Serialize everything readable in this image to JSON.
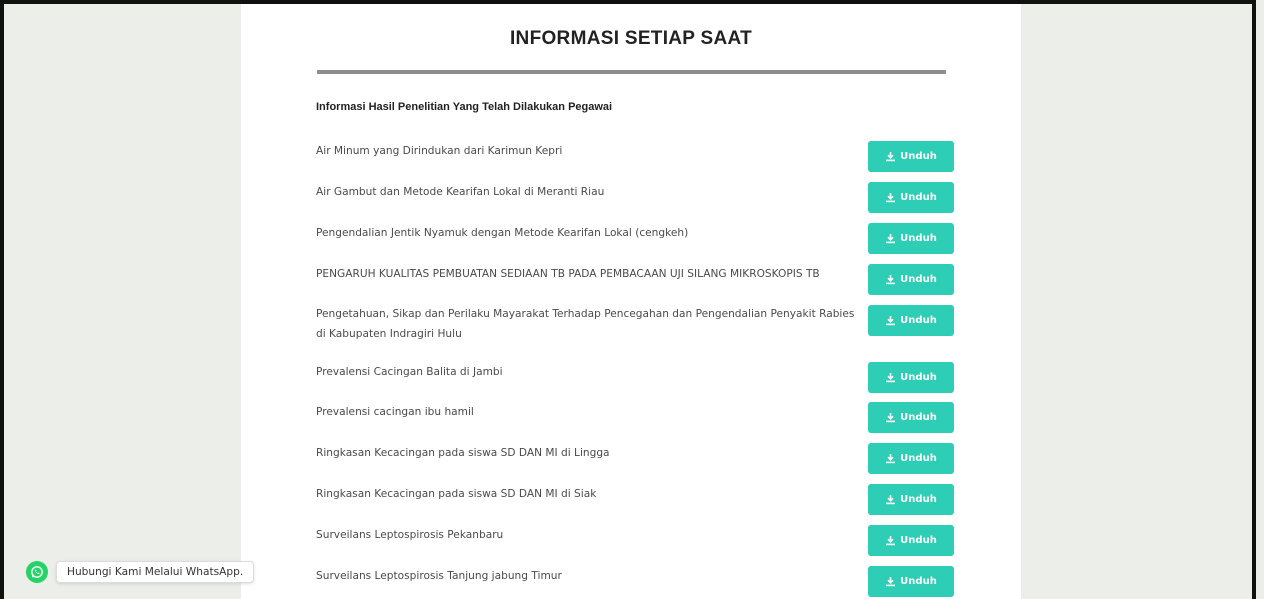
{
  "page": {
    "title": "INFORMASI SETIAP SAAT",
    "section_heading": "Informasi Hasil Penelitian Yang Telah Dilakukan Pegawai"
  },
  "download_label": "Unduh",
  "colors": {
    "button": "#2ecdb5",
    "whatsapp": "#25d366",
    "divider": "#8d8d8d"
  },
  "items": [
    {
      "title": "Air Minum yang Dirindukan dari Karimun Kepri",
      "button": "Unduh"
    },
    {
      "title": "Air Gambut dan Metode Kearifan Lokal di Meranti Riau",
      "button": "Unduh"
    },
    {
      "title": "Pengendalian Jentik Nyamuk dengan Metode Kearifan Lokal (cengkeh)",
      "button": "Unduh"
    },
    {
      "title": "PENGARUH KUALITAS PEMBUATAN SEDIAAN TB PADA PEMBACAAN UJI SILANG MIKROSKOPIS TB",
      "button": "Unduh"
    },
    {
      "title": "Pengetahuan, Sikap dan Perilaku Mayarakat Terhadap Pencegahan dan Pengendalian Penyakit Rabies di Kabupaten Indragiri Hulu",
      "button": "Unduh"
    },
    {
      "title": "Prevalensi Cacingan Balita di Jambi",
      "button": "Unduh"
    },
    {
      "title": "Prevalensi cacingan ibu hamil",
      "button": "Unduh"
    },
    {
      "title": "Ringkasan Kecacingan pada siswa SD DAN MI di Lingga",
      "button": "Unduh"
    },
    {
      "title": "Ringkasan Kecacingan pada siswa SD DAN MI di Siak",
      "button": "Unduh"
    },
    {
      "title": "Surveilans Leptospirosis Pekanbaru",
      "button": "Unduh"
    },
    {
      "title": "Surveilans Leptospirosis Tanjung jabung Timur",
      "button": "Unduh"
    }
  ],
  "whatsapp": {
    "label": "Hubungi Kami Melalui WhatsApp.",
    "icon": "whatsapp-icon"
  }
}
